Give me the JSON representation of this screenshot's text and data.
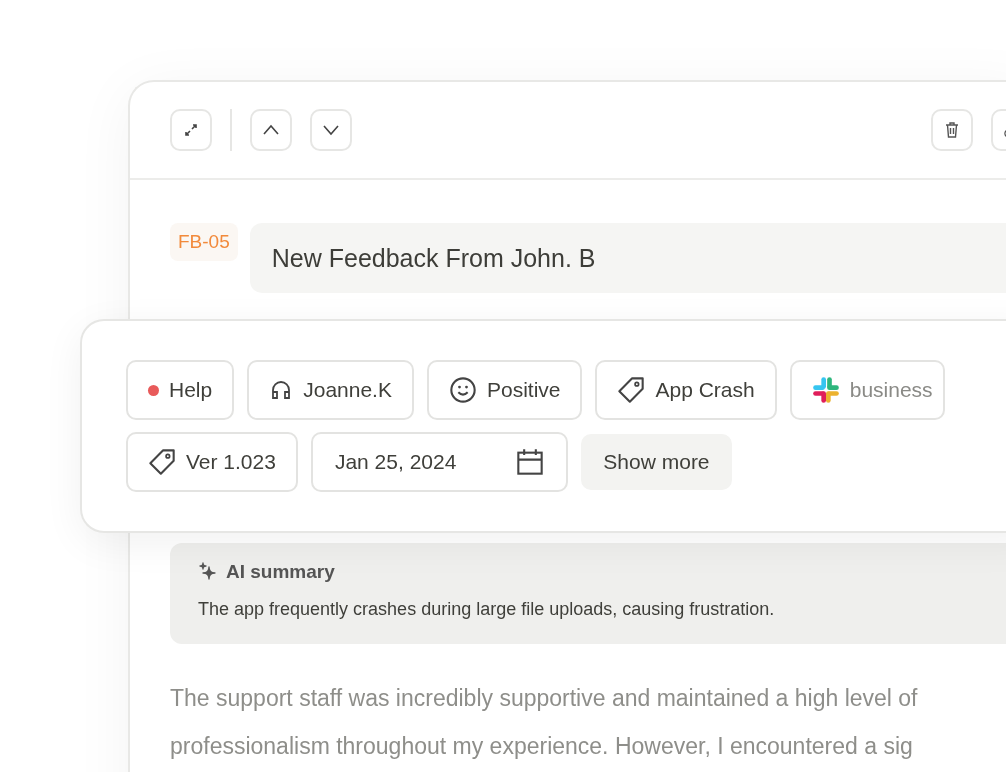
{
  "toolbar": {
    "buttons": [
      {
        "kind": "expand"
      },
      {
        "kind": "up"
      },
      {
        "kind": "down"
      },
      {
        "kind": "delete"
      },
      {
        "kind": "link"
      }
    ]
  },
  "feedback": {
    "id": "FB-05",
    "title": "New Feedback From John. B"
  },
  "property_rows": [
    [
      {
        "kind": "status",
        "label": "Help",
        "color": "#e85a5a"
      },
      {
        "kind": "assignee",
        "label": "Joanne.K"
      },
      {
        "kind": "sentiment",
        "label": "Positive"
      },
      {
        "kind": "tag",
        "label": "App Crash"
      },
      {
        "kind": "source",
        "label": "business"
      }
    ],
    [
      {
        "kind": "tag",
        "label": "Ver 1.023"
      },
      {
        "kind": "date",
        "label": "Jan 25, 2024"
      },
      {
        "kind": "more",
        "label": "Show more"
      }
    ]
  ],
  "ai_summary": {
    "title": "AI summary",
    "text": "The app frequently crashes during large file uploads, causing frustration."
  },
  "body_lines": [
    "The support staff was incredibly supportive and maintained a high level of",
    "professionalism throughout my experience. However, I encountered a sig"
  ]
}
